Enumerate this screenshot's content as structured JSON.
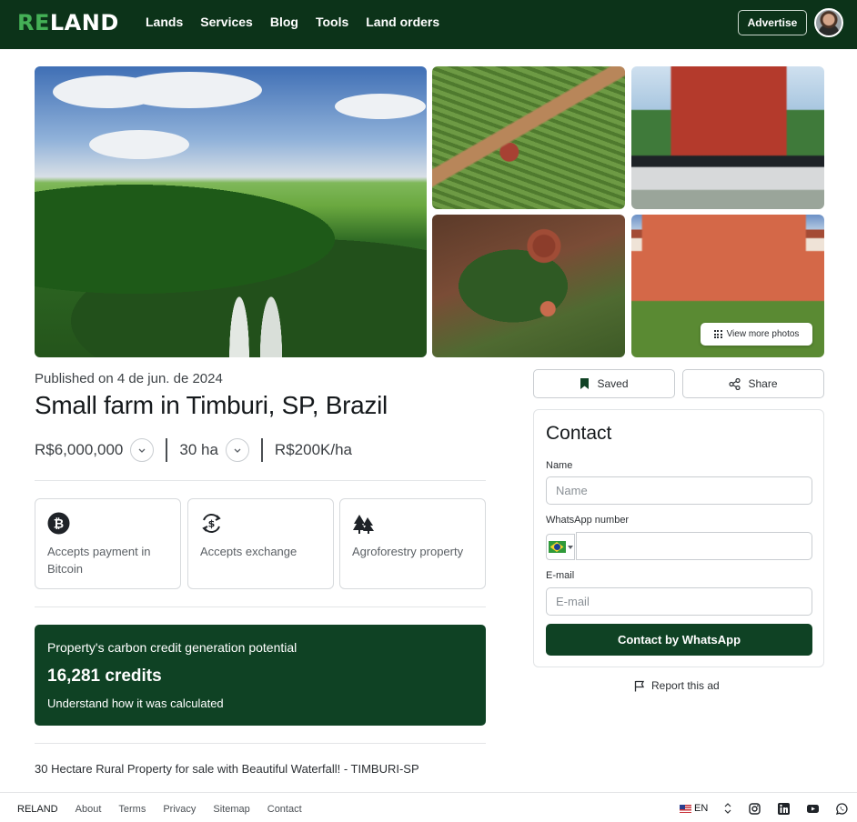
{
  "header": {
    "logo_re": "RE",
    "logo_land": "LAND",
    "nav": [
      "Lands",
      "Services",
      "Blog",
      "Tools",
      "Land orders"
    ],
    "advertise_label": "Advertise"
  },
  "gallery": {
    "view_more_label": "View more photos"
  },
  "listing": {
    "published": "Published on 4 de jun. de 2024",
    "title": "Small farm in Timburi, SP, Brazil",
    "price": "R$6,000,000",
    "area": "30 ha",
    "price_per_area": "R$200K/ha",
    "features": [
      {
        "label": "Accepts payment in Bitcoin",
        "icon": "bitcoin-icon"
      },
      {
        "label": "Accepts exchange",
        "icon": "exchange-icon"
      },
      {
        "label": "Agroforestry property",
        "icon": "trees-icon"
      }
    ],
    "carbon": {
      "heading": "Property's carbon credit generation potential",
      "credits": "16,281 credits",
      "link": "Understand how it was calculated"
    },
    "description": "30 Hectare Rural Property for sale with Beautiful Waterfall! - TIMBURI-SP"
  },
  "actions": {
    "saved_label": "Saved",
    "share_label": "Share"
  },
  "contact": {
    "heading": "Contact",
    "name_label": "Name",
    "name_placeholder": "Name",
    "whatsapp_label": "WhatsApp number",
    "email_label": "E-mail",
    "email_placeholder": "E-mail",
    "submit_label": "Contact by WhatsApp"
  },
  "report_label": "Report this ad",
  "footer": {
    "brand": "RELAND",
    "links": [
      "About",
      "Terms",
      "Privacy",
      "Sitemap",
      "Contact"
    ],
    "language": "EN"
  },
  "colors": {
    "brand_dark": "#0c3319",
    "brand_green": "#44b056",
    "accent_button": "#0f4224"
  }
}
